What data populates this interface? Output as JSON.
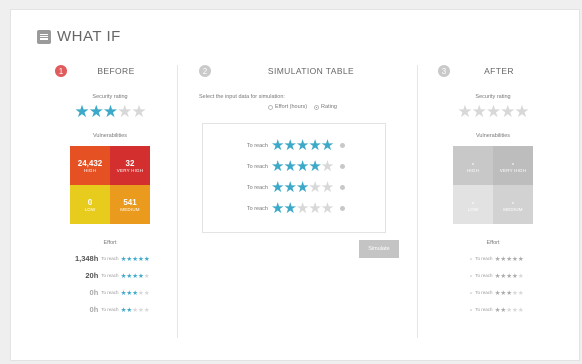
{
  "title": "WHAT IF",
  "before": {
    "step": "1",
    "header": "BEFORE",
    "security_label": "Security rating",
    "stars_on": "★★★",
    "stars_off": "★★",
    "vuln_label": "Vulnerabilities",
    "grid": {
      "high": {
        "value": "24,432",
        "label": "HIGH"
      },
      "very_high": {
        "value": "32",
        "label": "VERY HIGH"
      },
      "low": {
        "value": "0",
        "label": "LOW"
      },
      "medium": {
        "value": "541",
        "label": "MEDIUM"
      }
    },
    "effort_label": "Effort",
    "effort": [
      {
        "value": "1,348h",
        "to": "To reach",
        "on": "★★★★★",
        "off": ""
      },
      {
        "value": "20h",
        "to": "To reach",
        "on": "★★★★",
        "off": "★"
      },
      {
        "value": "0h",
        "to": "To reach",
        "on": "★★★",
        "off": "★★"
      },
      {
        "value": "0h",
        "to": "To reach",
        "on": "★★",
        "off": "★★★"
      }
    ]
  },
  "simulation": {
    "step": "2",
    "header": "SIMULATION TABLE",
    "instruction": "Select the input data for simulation:",
    "option_effort": "Effort (hours)",
    "option_rating": "Rating",
    "rows": [
      {
        "to": "To reach",
        "on": "★★★★★",
        "off": ""
      },
      {
        "to": "To reach",
        "on": "★★★★",
        "off": "★"
      },
      {
        "to": "To reach",
        "on": "★★★",
        "off": "★★"
      },
      {
        "to": "To reach",
        "on": "★★",
        "off": "★★★"
      }
    ],
    "simulate_button": "Simulate"
  },
  "after": {
    "step": "3",
    "header": "AFTER",
    "security_label": "Security rating",
    "stars": "★★★★★",
    "vuln_label": "Vulnerabilities",
    "grid": {
      "high": {
        "value": "-",
        "label": "HIGH"
      },
      "very_high": {
        "value": "-",
        "label": "VERY HIGH"
      },
      "low": {
        "value": "-",
        "label": "LOW"
      },
      "medium": {
        "value": "-",
        "label": "MEDIUM"
      }
    },
    "effort_label": "Effort",
    "effort": [
      {
        "value": "-",
        "to": "To reach",
        "on": "★★★★★",
        "off": ""
      },
      {
        "value": "-",
        "to": "To reach",
        "on": "★★★★",
        "off": "★"
      },
      {
        "value": "-",
        "to": "To reach",
        "on": "★★★",
        "off": "★★"
      },
      {
        "value": "-",
        "to": "To reach",
        "on": "★★",
        "off": "★★★"
      }
    ]
  },
  "colors": {
    "star_on": "#3da9c9",
    "high": "#e55123",
    "very_high": "#d32f2f",
    "low": "#e8cc1d",
    "medium": "#ea9a1c",
    "step_active": "#e05b5b"
  }
}
